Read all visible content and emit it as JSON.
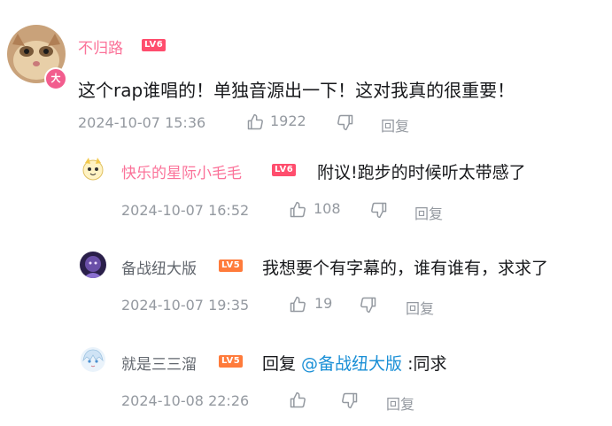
{
  "comment": {
    "username": "不归路",
    "level": "LV6",
    "vip_badge": "大",
    "text": "这个rap谁唱的！单独音源出一下！这对我真的很重要！",
    "timestamp": "2024-10-07 15:36",
    "likes": "1922",
    "reply_label": "回复"
  },
  "replies": [
    {
      "username": "快乐的星际小毛毛",
      "level": "LV6",
      "text": "附议!跑步的时候听太带感了",
      "timestamp": "2024-10-07 16:52",
      "likes": "108",
      "reply_label": "回复"
    },
    {
      "username": "备战纽大版",
      "level": "LV5",
      "text": "我想要个有字幕的，谁有谁有，求求了",
      "timestamp": "2024-10-07 19:35",
      "likes": "19",
      "reply_label": "回复"
    },
    {
      "username": "就是三三溜",
      "level": "LV5",
      "text_prefix": "回复 ",
      "mention": "@备战纽大版",
      "text_suffix": " :同求",
      "timestamp": "2024-10-08 22:26",
      "reply_label": "回复"
    }
  ],
  "colors": {
    "vip_name": "#fb7299",
    "normal_name": "#61666d",
    "meta": "#9499a0",
    "mention": "#1a8fd6",
    "lv6": "#ff4d6d",
    "lv5": "#ff7b3b"
  },
  "icons": [
    "thumbs-up-icon",
    "thumbs-down-icon"
  ]
}
